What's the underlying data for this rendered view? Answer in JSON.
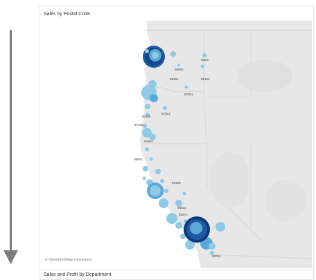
{
  "dashboard": {
    "sales_map_title": "Sales by Postal Code",
    "sales_profit_title": "Sales and Profit by Department"
  },
  "map": {
    "attribution": "© OpenStreetMap contributors",
    "postal_labels": [
      "98037",
      "98891",
      "99362",
      "99163",
      "97801",
      "97351",
      "97420",
      "97405",
      "97504",
      "95501",
      "96150",
      "95833",
      "93277",
      "92024"
    ],
    "colors": {
      "land": "#e7e7e8",
      "water": "#ffffff",
      "marker_light": "#8ec9e6",
      "marker_mid": "#5aa8d6",
      "marker_dark": "#1e5aa3",
      "marker_navy": "#0d3a78"
    }
  },
  "scroll_indicator": {
    "direction": "down",
    "color": "#7d7d7d"
  }
}
